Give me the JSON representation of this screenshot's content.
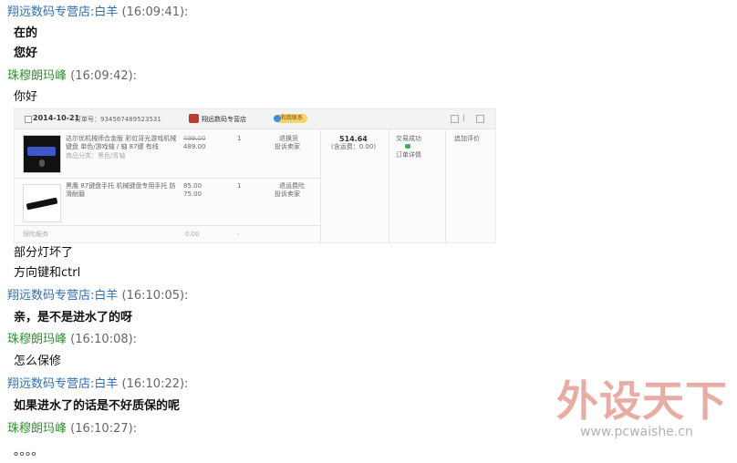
{
  "messages": [
    {
      "sender": "翔远数码专营店:白羊",
      "time": "(16:09:41):",
      "lines": [
        "在的",
        "您好"
      ]
    },
    {
      "sender": "珠穆朗玛峰",
      "time": "(16:09:42):",
      "lines": [
        "你好"
      ]
    },
    {
      "lines": [
        "部分灯坏了",
        "方向键和ctrl"
      ]
    },
    {
      "sender": "翔远数码专营店:白羊",
      "time": "(16:10:05):",
      "lines": [
        "亲，是不是进水了的呀"
      ]
    },
    {
      "sender": "珠穆朗玛峰",
      "time": "(16:10:08):",
      "lines": [
        "怎么保修"
      ]
    },
    {
      "sender": "翔远数码专营店:白羊",
      "time": "(16:10:22):",
      "lines": [
        "如果进水了的话是不好质保的呢"
      ]
    },
    {
      "sender": "珠穆朗玛峰",
      "time": "(16:10:27):",
      "lines": [
        "。。。。"
      ]
    }
  ],
  "order_card": {
    "date": "2014-10-21",
    "order_no": "订单号：934567489523531",
    "shop_name": "翔远数码专营店",
    "contact_label": "和我联系",
    "items": [
      {
        "title_line1": "达尔优机械师合金版 彩虹背光游戏机械",
        "title_line2": "键盘 单色/游戏轴 / 轴 87键 有线",
        "title_line3": "商品分类：黑色/青轴",
        "orig_price": "499.00",
        "price": "489.00",
        "qty": "1",
        "service_line1": "退换货",
        "service_line2": "投诉卖家"
      },
      {
        "title_line1": "黑鹰 87键盘手托 机械键盘专用手托 防",
        "title_line2": "滑耐磨",
        "title_line3": "",
        "orig_price": "85.00",
        "price": "75.00",
        "qty": "1",
        "service_line1": "退运费险",
        "service_line2": "投诉卖家"
      }
    ],
    "total": "514.64",
    "shipping": "(含运费：0.00)",
    "status": "交易成功",
    "status_detail": "订单详情",
    "action": "追加评价",
    "footer_label": "保险服务",
    "footer_value": "0.00",
    "footer_dash": "-"
  },
  "watermark": {
    "text": "外设天下",
    "url": "www.pcwaishe.cn"
  },
  "colors": {
    "seller_name": "#2e6fb5",
    "buyer_name": "#2f8f2f",
    "timestamp": "#666666"
  }
}
